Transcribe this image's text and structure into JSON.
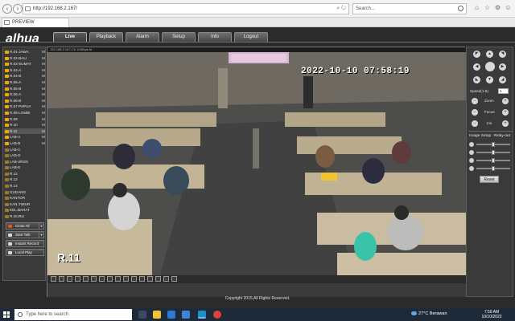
{
  "browser": {
    "url": "http://192.168.2.167/",
    "search_placeholder": "Search...",
    "tab_title": "PREVIEW"
  },
  "app": {
    "logo": "alhua",
    "menu": [
      {
        "label": "Live",
        "active": true
      },
      {
        "label": "Playback",
        "active": false
      },
      {
        "label": "Alarm",
        "active": false
      },
      {
        "label": "Setup",
        "active": false
      },
      {
        "label": "Info",
        "active": false
      },
      {
        "label": "Logout",
        "active": false
      }
    ]
  },
  "channels": [
    {
      "name": "R.01-JAWA",
      "mode": "M"
    },
    {
      "name": "R.02-BALI",
      "mode": "M"
    },
    {
      "name": "R.03-SUMAT",
      "mode": "M"
    },
    {
      "name": "R.04-A",
      "mode": "M"
    },
    {
      "name": "R.04-B",
      "mode": "M"
    },
    {
      "name": "R.05-A",
      "mode": "M"
    },
    {
      "name": "R.05-B",
      "mode": "M"
    },
    {
      "name": "R.06-A",
      "mode": "M"
    },
    {
      "name": "R.06-B",
      "mode": "M"
    },
    {
      "name": "R.07-PAPUA",
      "mode": "M"
    },
    {
      "name": "R.08-LOMBI",
      "mode": "M"
    },
    {
      "name": "R.09",
      "mode": "M"
    },
    {
      "name": "R.10",
      "mode": "M"
    },
    {
      "name": "R.11",
      "mode": "M",
      "selected": true
    },
    {
      "name": "LAB-A",
      "mode": "M"
    },
    {
      "name": "LAB-B",
      "mode": "M"
    },
    {
      "name": "LAB-C",
      "mode": ""
    },
    {
      "name": "LAB-D",
      "mode": ""
    },
    {
      "name": "LAB-JRGN",
      "mode": ""
    },
    {
      "name": "LAB-E",
      "mode": ""
    },
    {
      "name": "R.12",
      "mode": ""
    },
    {
      "name": "R.13",
      "mode": ""
    },
    {
      "name": "R.14",
      "mode": ""
    },
    {
      "name": "GUDANG",
      "mode": ""
    },
    {
      "name": "KANTOR",
      "mode": ""
    },
    {
      "name": "KAN.TIMUR",
      "mode": ""
    },
    {
      "name": "KEL.BARAT",
      "mode": ""
    },
    {
      "name": "R.GURU",
      "mode": ""
    }
  ],
  "controls": {
    "close_all": "Close All",
    "start_talk": "Start Talk",
    "instant_record": "Instant Record",
    "local_play": "Local Play"
  },
  "video": {
    "header": "192.168.2.167-Ch 1/0Kbps M",
    "timestamp": "2022-10-10 07:58:19",
    "channel_label": "R.11"
  },
  "ptz": {
    "speed_label": "Speed(1-8)",
    "speed_value": "5",
    "zoom_label": "Zoom",
    "focus_label": "Focus",
    "iris_label": "Iris",
    "image_setup_label": "Image Setup",
    "relay_label": "Relay-out",
    "reset_label": "Reset"
  },
  "footer": {
    "copyright": "Copyright 2015,All Rights Reserved."
  },
  "taskbar": {
    "search_placeholder": "Type here to search",
    "weather": "27°C  Berawan",
    "time": "7:59 AM",
    "date": "10/10/2022"
  },
  "colors": {
    "accent_orange": "#f2a900",
    "panel_bg": "#3a3a3a",
    "app_bg": "#2b2b2b",
    "taskbar_bg": "#1f2a38"
  }
}
